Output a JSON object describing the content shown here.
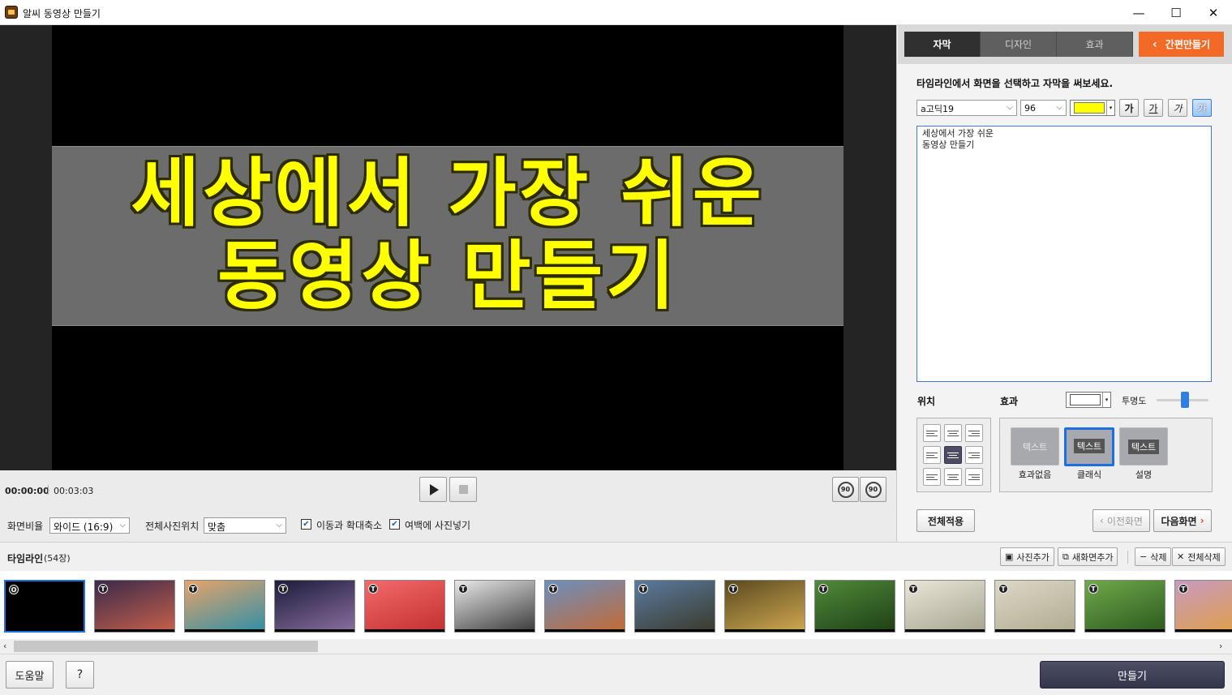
{
  "window": {
    "title": "알씨 동영상 만들기",
    "minimize": "—",
    "maximize": "☐",
    "close": "✕"
  },
  "preview": {
    "caption_line1": "세상에서 가장 쉬운",
    "caption_line2": "동영상 만들기"
  },
  "player": {
    "time_current": "00:00:00",
    "time_total": "00:03:03",
    "rotate_left": "90",
    "rotate_right": "90"
  },
  "options": {
    "ratio_label": "화면비율",
    "ratio_value": "와이드 (16:9)",
    "photo_pos_label": "전체사진위치",
    "photo_pos_value": "맞춤",
    "check_zoom_label": "이동과 확대축소",
    "check_zoom": true,
    "check_margin_label": "여백에 사진넣기",
    "check_margin": true
  },
  "right_panel": {
    "tabs": [
      "자막",
      "디자인",
      "효과"
    ],
    "active_tab": "자막",
    "easy_button": "간편만들기",
    "instruction": "타임라인에서 화면을 선택하고 자막을 써보세요.",
    "font_value": "a고딕19",
    "size_value": "96",
    "text_color": "#ffff00",
    "format_buttons": [
      "가",
      "가",
      "가",
      "가"
    ],
    "text_value": "세상에서 가장 쉬운\n동영상 만들기",
    "position_label": "위치",
    "effect_label": "효과",
    "effect_color": "#ffffff",
    "opacity_label": "투명도",
    "opacity": 0.55,
    "effects": [
      {
        "sample": "텍스트",
        "label": "효과없음"
      },
      {
        "sample": "텍스트",
        "label": "클래식"
      },
      {
        "sample": "텍스트",
        "label": "설명"
      }
    ],
    "selected_effect": 1,
    "apply_all": "전체적용",
    "prev_screen": "이전화면",
    "next_screen": "다음화면"
  },
  "timeline": {
    "title": "타임라인",
    "count": "(54장)",
    "add_photo": "사진추가",
    "add_screen": "새화면추가",
    "delete": "삭제",
    "delete_all": "전체삭제",
    "thumbs": [
      {
        "badge": "O",
        "colors": [
          "#000000",
          "#000000"
        ]
      },
      {
        "badge": "T",
        "colors": [
          "#3a2a4a",
          "#c8604a"
        ]
      },
      {
        "badge": "T",
        "colors": [
          "#e6a46a",
          "#2f8fa6"
        ]
      },
      {
        "badge": "T",
        "colors": [
          "#1c1b3a",
          "#8a6fa0"
        ]
      },
      {
        "badge": "T",
        "colors": [
          "#f26a6a",
          "#c33030"
        ]
      },
      {
        "badge": "T",
        "colors": [
          "#e8e8e8",
          "#3a3a3a"
        ]
      },
      {
        "badge": "T",
        "colors": [
          "#6a8fc0",
          "#c56a34"
        ]
      },
      {
        "badge": "T",
        "colors": [
          "#5a7aa0",
          "#3a3a2a"
        ]
      },
      {
        "badge": "T",
        "colors": [
          "#5a4a20",
          "#d0a850"
        ]
      },
      {
        "badge": "T",
        "colors": [
          "#4f8a3a",
          "#1f3f14"
        ]
      },
      {
        "badge": "T",
        "colors": [
          "#e9e6d8",
          "#a8a490"
        ]
      },
      {
        "badge": "T",
        "colors": [
          "#dcd8c6",
          "#b0ab90"
        ]
      },
      {
        "badge": "T",
        "colors": [
          "#6fa84a",
          "#2c5a1e"
        ]
      },
      {
        "badge": "T",
        "colors": [
          "#c89ac0",
          "#e0a040"
        ]
      }
    ]
  },
  "bottom": {
    "help": "도움말",
    "question": "?",
    "make": "만들기"
  }
}
